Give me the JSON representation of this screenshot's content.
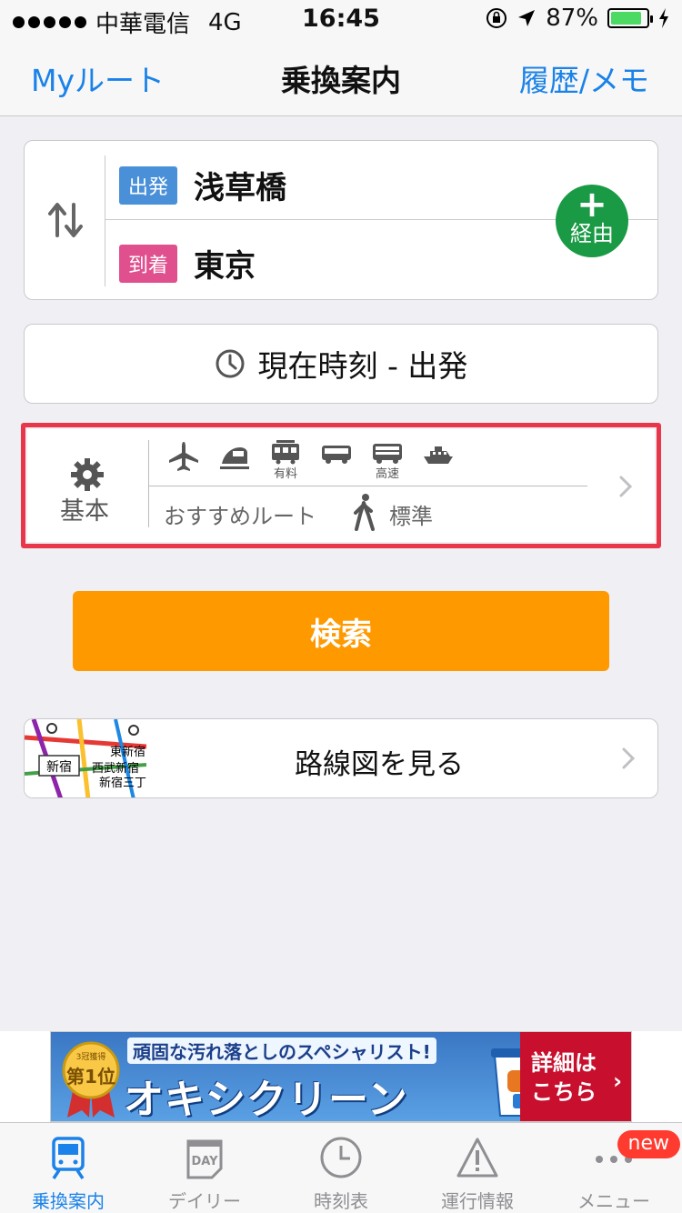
{
  "status_bar": {
    "carrier": "中華電信",
    "network": "4G",
    "time": "16:45",
    "battery": "87%",
    "battery_level": 0.87
  },
  "nav": {
    "left": "Myルート",
    "title": "乗換案内",
    "right": "履歴/メモ"
  },
  "route": {
    "departure_tag": "出発",
    "departure": "浅草橋",
    "arrival_tag": "到着",
    "arrival": "東京",
    "via_plus": "+",
    "via_label": "経由"
  },
  "time_setting": {
    "label": "現在時刻 - 出発"
  },
  "basic": {
    "label": "基本",
    "modes": [
      {
        "icon": "airplane-icon",
        "label": ""
      },
      {
        "icon": "shinkansen-icon",
        "label": ""
      },
      {
        "icon": "paid-train-icon",
        "label": "有料"
      },
      {
        "icon": "bus-icon",
        "label": ""
      },
      {
        "icon": "highway-bus-icon",
        "label": "高速"
      },
      {
        "icon": "ferry-icon",
        "label": ""
      }
    ],
    "route_pref": "おすすめルート",
    "walk_speed": "標準",
    "highlight_color": "#e8374a"
  },
  "search_button": "検索",
  "map_link": {
    "label": "路線図を見る",
    "stations": [
      "新宿",
      "西武新宿",
      "東新宿",
      "新宿三丁"
    ]
  },
  "ad": {
    "top": "頑固な汚れ落としのスペシャリスト!",
    "main": "オキシクリーン",
    "badge_top": "3冠獲得",
    "badge_rank": "第1位",
    "detail_line1": "詳細は",
    "detail_line2": "こちら",
    "detail_arrow": "›"
  },
  "tabs": [
    {
      "label": "乗換案内",
      "icon": "train-icon",
      "active": true
    },
    {
      "label": "デイリー",
      "icon": "calendar-day-icon",
      "icon_text": "DAY",
      "active": false
    },
    {
      "label": "時刻表",
      "icon": "clock-icon",
      "active": false
    },
    {
      "label": "運行情報",
      "icon": "warning-icon",
      "active": false
    },
    {
      "label": "メニュー",
      "icon": "more-icon",
      "badge": "new",
      "active": false
    }
  ],
  "colors": {
    "link_blue": "#1a82e8",
    "search_orange": "#ff9900",
    "via_green": "#1a9a44",
    "departure_blue": "#4a90d9",
    "arrival_pink": "#e0508e"
  }
}
